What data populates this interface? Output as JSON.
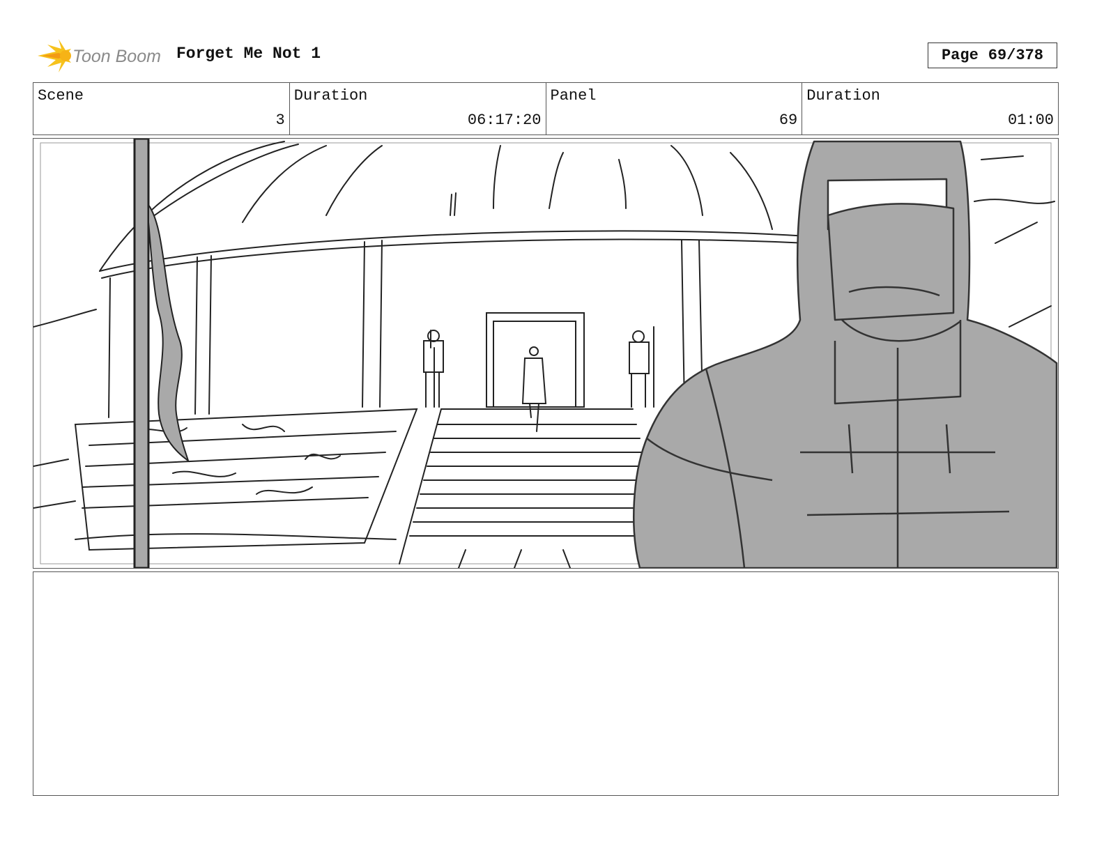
{
  "header": {
    "logo_text": "Toon Boom",
    "project_title": "Forget Me Not 1",
    "page_label": "Page",
    "page_number": "69/378"
  },
  "info": {
    "scene_label": "Scene",
    "scene_value": "3",
    "scene_duration_label": "Duration",
    "scene_duration_value": "06:17:20",
    "panel_label": "Panel",
    "panel_value": "69",
    "panel_duration_label": "Duration",
    "panel_duration_value": "01:00"
  },
  "panel": {
    "image_subject": "storyboard-sketch-temple-guard",
    "fill_color": "#a9a9a9",
    "line_color": "#222222"
  },
  "notes": {
    "text": ""
  }
}
